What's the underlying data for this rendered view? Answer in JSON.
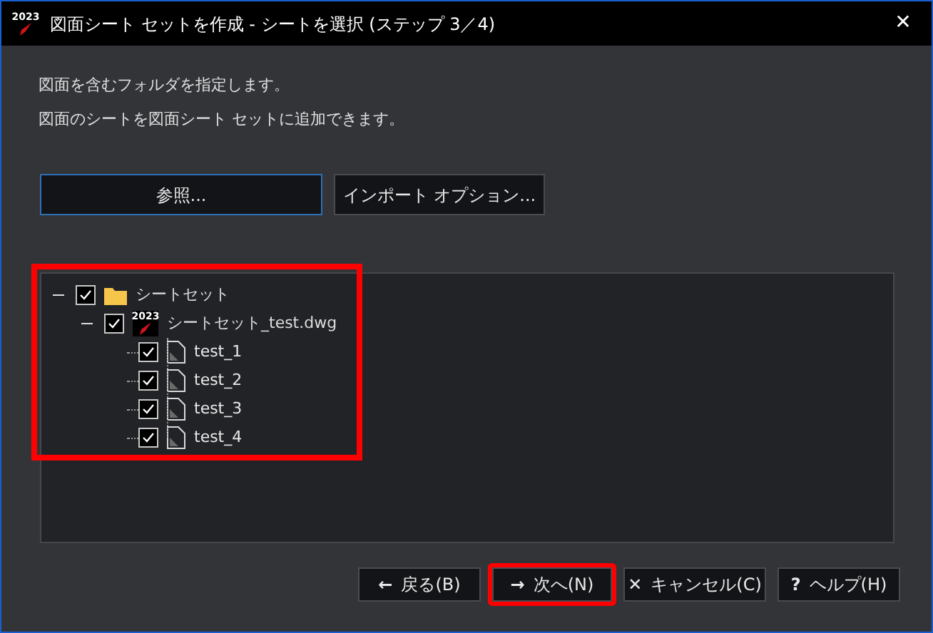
{
  "window": {
    "icon_label": "2023",
    "title": "図面シート セットを作成 - シートを選択 (ステップ 3／4)",
    "close": "✕"
  },
  "intro": [
    "図面を含むフォルダを指定します。",
    "図面のシートを図面シート セットに追加できます。"
  ],
  "top_buttons": [
    {
      "label": "参照...",
      "focused": true
    },
    {
      "label": "インポート オプション...",
      "focused": false
    }
  ],
  "tree": {
    "highlighted": true,
    "nodes": [
      {
        "kind": "folder",
        "label": "シートセット",
        "checked": true,
        "expanded": true,
        "children": [
          {
            "kind": "drawing",
            "label": "シートセット_test.dwg",
            "icon_label": "2023",
            "checked": true,
            "expanded": true,
            "children": [
              {
                "kind": "sheet",
                "label": "test_1",
                "checked": true
              },
              {
                "kind": "sheet",
                "label": "test_2",
                "checked": true
              },
              {
                "kind": "sheet",
                "label": "test_3",
                "checked": true
              },
              {
                "kind": "sheet",
                "label": "test_4",
                "checked": true
              }
            ]
          }
        ]
      }
    ]
  },
  "bottom_buttons": [
    {
      "kind": "back",
      "icon": "←",
      "label": "戻る(B)",
      "highlighted": false
    },
    {
      "kind": "next",
      "icon": "→",
      "label": "次へ(N)",
      "highlighted": true
    },
    {
      "kind": "cancel",
      "icon": "✕",
      "label": "キャンセル(C)",
      "highlighted": false
    },
    {
      "kind": "help",
      "icon": "?",
      "label": "ヘルプ(H)",
      "highlighted": false
    }
  ]
}
